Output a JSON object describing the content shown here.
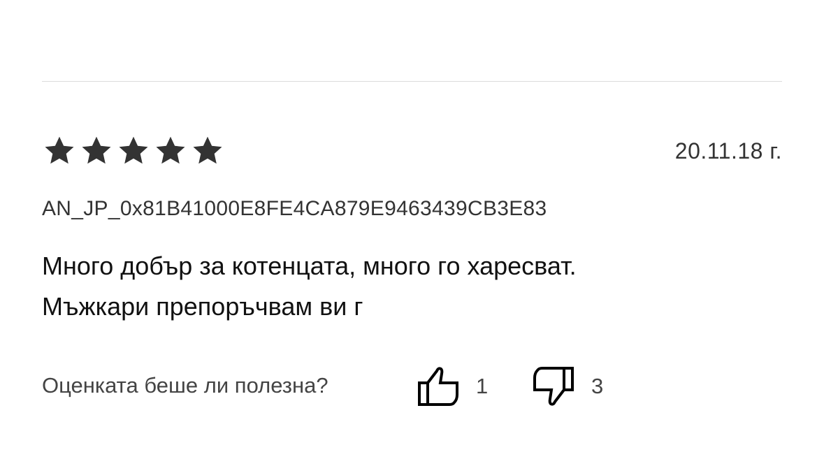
{
  "review": {
    "rating": 5,
    "rating_max": 5,
    "date": "20.11.18 г.",
    "author": "AN_JP_0x81B41000E8FE4CA879E9463439CB3E83",
    "text_line1": "Много добър за котенцата, много го харесват.",
    "text_line2": "Мъжкари препоръчвам ви г"
  },
  "helpful": {
    "question": "Оценката беше ли полезна?",
    "likes": "1",
    "dislikes": "3"
  },
  "colors": {
    "star": "#333333",
    "divider": "#dcdcdc",
    "text": "#111111"
  },
  "icons": {
    "rating": "star-icon",
    "like": "thumbs-up-icon",
    "dislike": "thumbs-down-icon"
  }
}
